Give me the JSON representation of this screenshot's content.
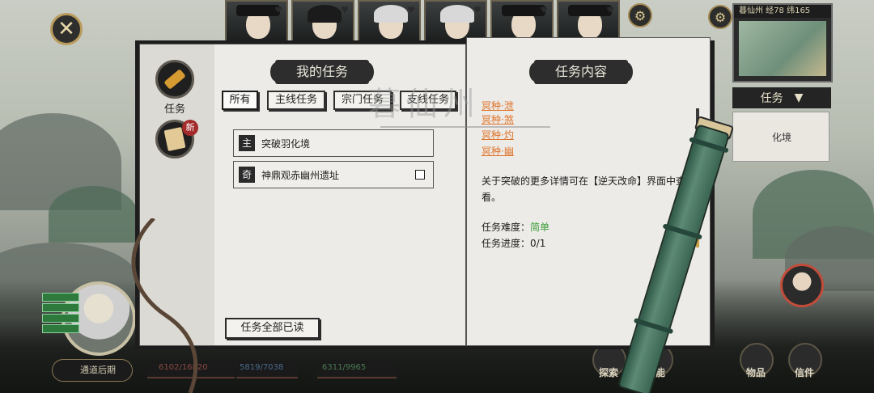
{
  "hud": {
    "close_icon": "close-icon",
    "minimap_title": "暮仙州 经78 纬165",
    "right_task_label": "任务",
    "right_panel_text": "化境",
    "name_plate": "通道后期",
    "stat1": "6102/16820",
    "stat2": "5819/7038",
    "stat3": "6311/9965",
    "btn_labels": [
      "探索",
      "技能",
      "物品",
      "信件"
    ]
  },
  "book": {
    "left_title": "我的任务",
    "right_title": "任务内容",
    "side_tabs": [
      {
        "label": "任务",
        "icon": "scroll-icon"
      },
      {
        "label": "",
        "icon": "paper-icon",
        "badge": "新"
      }
    ],
    "filters": [
      "所有",
      "主线任务",
      "宗门任务",
      "支线任务"
    ],
    "active_filter": "所有",
    "quests": [
      {
        "tag": "主",
        "name": "突破羽化境",
        "checkbox": false
      },
      {
        "tag": "奇",
        "name": "神鼎观赤幽州遗址",
        "checkbox": true
      }
    ],
    "read_all_button": "任务全部已读",
    "watermark": "暮仙州"
  },
  "detail": {
    "links": [
      "冥种·泄",
      "冥种·煞",
      "冥种·灼",
      "冥种·幽"
    ],
    "description": "关于突破的更多详情可在【逆天改命】界面中查看。",
    "difficulty_label": "任务难度：",
    "difficulty_value": "简单",
    "progress_label": "任务进度：",
    "progress_value": "0/1",
    "colors": {
      "link": "#e0742b",
      "easy": "#3d9d3a"
    }
  }
}
